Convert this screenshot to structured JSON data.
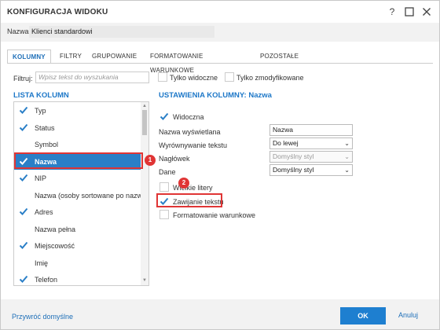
{
  "dialog": {
    "title": "KONFIGURACJA WIDOKU",
    "help_label": "?",
    "maximize_label": "☐",
    "close_label": "✕"
  },
  "name": {
    "label": "Nazwa:",
    "value": "Klienci standardowi"
  },
  "tabs": [
    {
      "label": "KOLUMNY",
      "active": true
    },
    {
      "label": "FILTRY",
      "active": false
    },
    {
      "label": "GRUPOWANIE",
      "active": false
    },
    {
      "label": "FORMATOWANIE WARUNKOWE",
      "active": false
    },
    {
      "label": "POZOSTAŁE",
      "active": false
    }
  ],
  "filter": {
    "label": "Filtruj:",
    "placeholder": "Wpisz tekst do wyszukania",
    "only_visible": "Tylko widoczne",
    "only_modified": "Tylko zmodyfikowane"
  },
  "column_list": {
    "title": "LISTA KOLUMN",
    "items": [
      {
        "label": "Typ",
        "checked": true,
        "selected": false
      },
      {
        "label": "Status",
        "checked": true,
        "selected": false
      },
      {
        "label": "Symbol",
        "checked": false,
        "selected": false
      },
      {
        "label": "Nazwa",
        "checked": true,
        "selected": true
      },
      {
        "label": "NIP",
        "checked": true,
        "selected": false
      },
      {
        "label": "Nazwa (osoby sortowane po nazwisku)",
        "checked": false,
        "selected": false
      },
      {
        "label": "Adres",
        "checked": true,
        "selected": false
      },
      {
        "label": "Nazwa pełna",
        "checked": false,
        "selected": false
      },
      {
        "label": "Miejscowość",
        "checked": true,
        "selected": false
      },
      {
        "label": "Imię",
        "checked": false,
        "selected": false
      },
      {
        "label": "Telefon",
        "checked": true,
        "selected": false
      }
    ]
  },
  "column_settings": {
    "title": "USTAWIENIA KOLUMNY: Nazwa",
    "visible_label": "Widoczna",
    "display_name_label": "Nazwa wyświetlana",
    "display_name_value": "Nazwa",
    "alignment_label": "Wyrównywanie tekstu",
    "alignment_value": "Do lewej",
    "header_label": "Nagłówek",
    "header_value": "Domyślny styl",
    "data_label": "Dane",
    "data_value": "Domyślny styl",
    "big_letters_label": "Wielkie litery",
    "wrap_label": "Zawijanie tekstu",
    "conditional_label": "Formatowanie warunkowe"
  },
  "badges": {
    "first": "1",
    "second": "2"
  },
  "footer": {
    "reset_label": "Przywróć domyślne",
    "ok_label": "OK",
    "cancel_label": "Anuluj"
  },
  "colors": {
    "accent": "#1e78c8",
    "selection": "#2a7fc7",
    "highlight": "#e03535",
    "check": "#2a7fc7"
  }
}
